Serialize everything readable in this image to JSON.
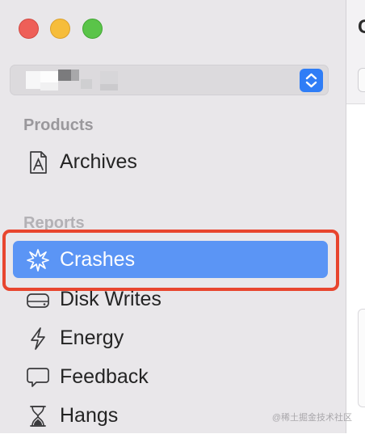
{
  "window": {
    "controls": [
      "close",
      "minimize",
      "zoom"
    ]
  },
  "sidebar": {
    "app_selector": {
      "value": "",
      "stepper_icon": "up-down-chevron-icon"
    },
    "sections": [
      {
        "header": "Products",
        "items": [
          {
            "label": "Archives",
            "icon": "archive-app-icon"
          }
        ]
      },
      {
        "header": "Reports",
        "items": [
          {
            "label": "Crashes",
            "icon": "crash-burst-icon",
            "selected": true
          },
          {
            "label": "Disk Writes",
            "icon": "disk-drive-icon"
          },
          {
            "label": "Energy",
            "icon": "lightning-bolt-icon"
          },
          {
            "label": "Feedback",
            "icon": "speech-bubble-icon"
          },
          {
            "label": "Hangs",
            "icon": "hourglass-icon"
          }
        ]
      }
    ]
  },
  "main": {
    "title_fragment": "C"
  },
  "watermark": "@稀土掘金技术社区",
  "colors": {
    "sidebar_bg": "#e9e7ea",
    "selection": "#5b95f5",
    "accent": "#2f7df6",
    "annotation": "#e8452e"
  }
}
